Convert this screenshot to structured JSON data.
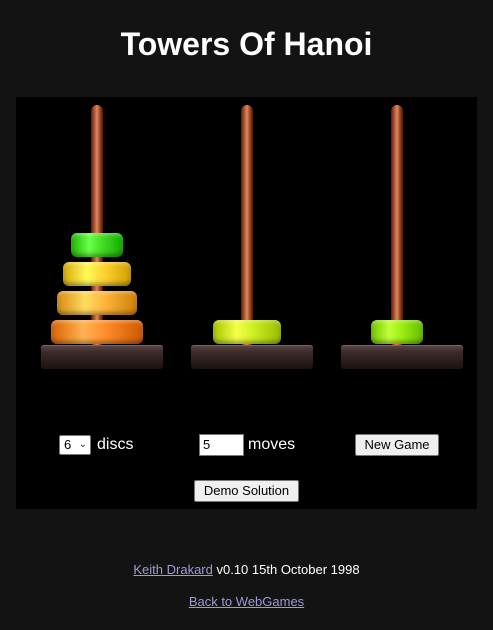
{
  "title": "Towers Of Hanoi",
  "towers": [
    {
      "name": "tower-1",
      "discs": [
        {
          "size": 4,
          "color": "#ff8b2a"
        },
        {
          "size": 3,
          "color": "#ffb33a"
        },
        {
          "size": 2,
          "color": "#ffd232"
        },
        {
          "size": 1,
          "color": "#44dd22"
        }
      ]
    },
    {
      "name": "tower-2",
      "discs": [
        {
          "size": 2,
          "color": "#ccee22"
        }
      ]
    },
    {
      "name": "tower-3",
      "discs": [
        {
          "size": 1,
          "color": "#99ee11"
        }
      ]
    }
  ],
  "controls": {
    "discs_value": "6",
    "discs_label": "discs",
    "moves_value": "5",
    "moves_label": "moves",
    "new_game_label": "New Game",
    "demo_label": "Demo Solution"
  },
  "footer": {
    "author_link": "Keith Drakard",
    "version_text": " v0.10 15th October 1998",
    "back_link": "Back to WebGames"
  },
  "colors": {
    "background": "#131313",
    "board": "#000000",
    "link": "#9b9bd9"
  }
}
